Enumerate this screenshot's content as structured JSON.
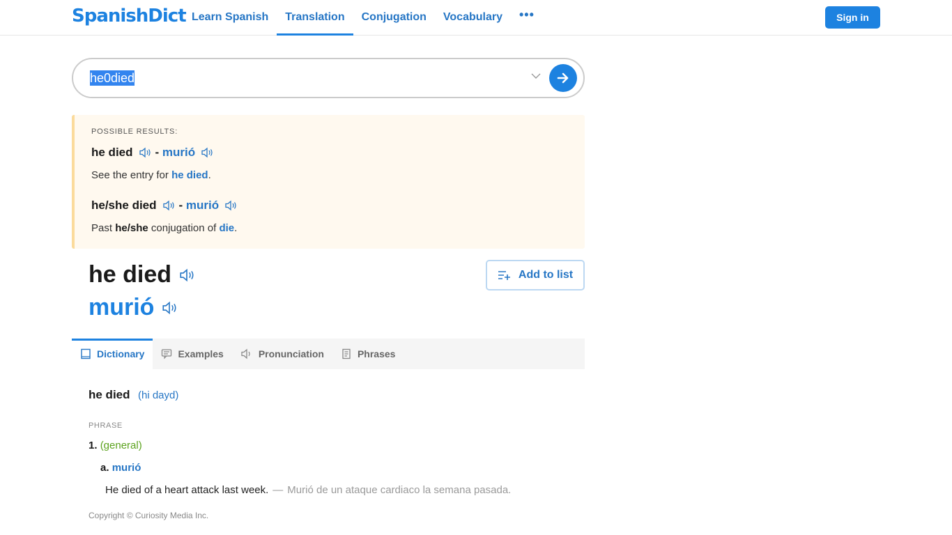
{
  "header": {
    "logo": "SpanishDict",
    "nav": [
      {
        "label": "Learn Spanish",
        "active": false
      },
      {
        "label": "Translation",
        "active": true
      },
      {
        "label": "Conjugation",
        "active": false
      },
      {
        "label": "Vocabulary",
        "active": false
      }
    ],
    "more_label": "•••",
    "sign_in": "Sign in"
  },
  "search": {
    "value": "he0died"
  },
  "possible_results": {
    "label": "POSSIBLE RESULTS:",
    "items": [
      {
        "english": "he died",
        "spanish": "murió",
        "desc_prefix": "See the entry for ",
        "desc_link": "he died",
        "desc_suffix": "."
      },
      {
        "english": "he/she died",
        "spanish": "murió",
        "desc_prefix": "Past ",
        "desc_bold": "he/she",
        "desc_mid": " conjugation of ",
        "desc_link": "die",
        "desc_suffix": "."
      }
    ]
  },
  "entry": {
    "headword": "he died",
    "translation": "murió",
    "add_to_list": "Add to list"
  },
  "tabs": [
    {
      "label": "Dictionary",
      "icon": "book-icon",
      "active": true
    },
    {
      "label": "Examples",
      "icon": "chat-icon",
      "active": false
    },
    {
      "label": "Pronunciation",
      "icon": "speaker-icon",
      "active": false
    },
    {
      "label": "Phrases",
      "icon": "document-icon",
      "active": false
    }
  ],
  "dictionary": {
    "headword": "he died",
    "pronunciation": "(hi dayd)",
    "part_of_speech": "PHRASE",
    "sense_number": "1.",
    "sense_context": "(general)",
    "sub_letter": "a.",
    "sub_translation": "murió",
    "example_en": "He died of a heart attack last week.",
    "example_dash": "—",
    "example_es": "Murió de un ataque cardiaco la semana pasada."
  },
  "footer": {
    "copyright": "Copyright © Curiosity Media Inc."
  },
  "colors": {
    "brand": "#1d82e0",
    "link": "#2676c5",
    "context_green": "#5ba21d",
    "possible_bg": "#fff9ef",
    "possible_border": "#fbdb9c"
  }
}
